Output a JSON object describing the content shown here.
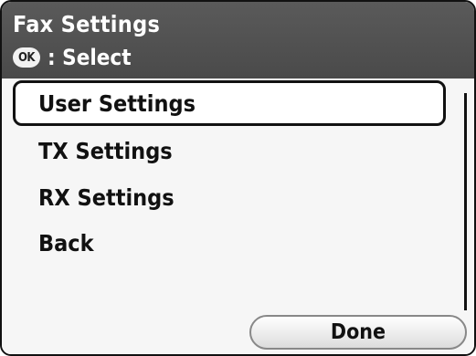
{
  "header": {
    "title": "Fax Settings",
    "ok_icon_text": "OK",
    "hint": ": Select"
  },
  "menu": {
    "items": [
      {
        "label": "User Settings",
        "selected": true
      },
      {
        "label": "TX Settings",
        "selected": false
      },
      {
        "label": "RX Settings",
        "selected": false
      },
      {
        "label": "Back",
        "selected": false
      }
    ]
  },
  "footer": {
    "done_label": "Done"
  },
  "icons": {
    "ok": "ok-button-icon"
  },
  "colors": {
    "header_bg": "#505050",
    "list_bg": "#f6f6f6",
    "selection_border": "#111111"
  }
}
